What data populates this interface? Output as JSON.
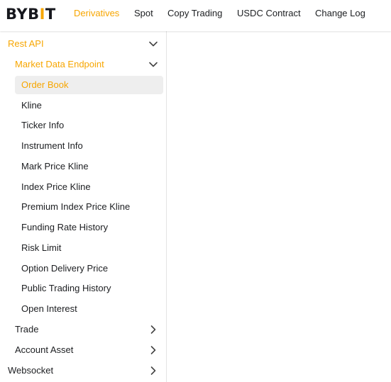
{
  "logo": {
    "text_pre": "BYB",
    "text_mark": "I",
    "text_post": "T",
    "accent": "#f7a600"
  },
  "nav": {
    "items": [
      "Derivatives",
      "Spot",
      "Copy Trading",
      "USDC Contract",
      "Change Log"
    ],
    "active": "Derivatives"
  },
  "sidebar": {
    "rest_api": "Rest API",
    "market_data": "Market Data Endpoint",
    "endpoints": [
      "Order Book",
      "Kline",
      "Ticker Info",
      "Instrument Info",
      "Mark Price Kline",
      "Index Price Kline",
      "Premium Index Price Kline",
      "Funding Rate History",
      "Risk Limit",
      "Option Delivery Price",
      "Public Trading History",
      "Open Interest"
    ],
    "selected": "Order Book",
    "trade": "Trade",
    "account_asset": "Account Asset",
    "websocket": "Websocket"
  },
  "colors": {
    "accent": "#f7a600",
    "text": "#1c1e21",
    "selected_bg": "#eeeeee"
  }
}
